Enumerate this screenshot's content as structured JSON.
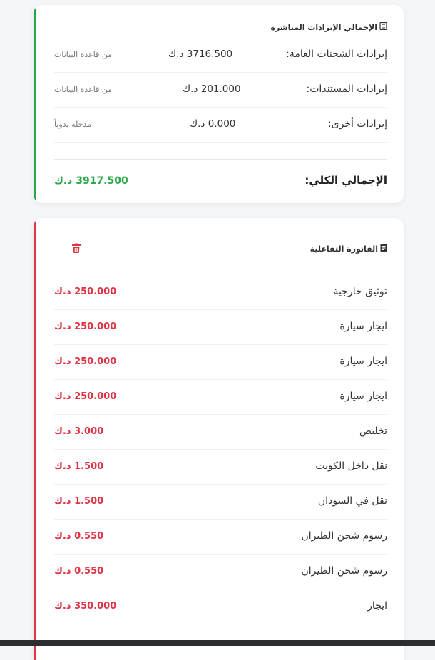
{
  "direct_revenue": {
    "title": "الإجمالي الإيرادات المباشرة",
    "icon": "calculator-icon",
    "accent_color": "#2aa74a",
    "rows": [
      {
        "label": "إيرادات الشحنات العامة:",
        "amount": "3716.500 د.ك",
        "source": "من قاعدة البيانات"
      },
      {
        "label": "إيرادات المستندات:",
        "amount": "201.000 د.ك",
        "source": "من قاعدة البيانات"
      },
      {
        "label": "إيرادات أخرى:",
        "amount": "0.000 د.ك",
        "source": "مدخلة يدوياً"
      }
    ],
    "total_label": "الإجمالي الكلي:",
    "total_value": "3917.500 د.ك"
  },
  "interactive_invoice": {
    "title": "الفاتورة التفاعلية",
    "icon": "invoice-icon",
    "delete_icon": "trash-icon",
    "accent_color": "#dc3545",
    "items": [
      {
        "name": "توثيق خارجية",
        "price": "250.000 د.ك"
      },
      {
        "name": "ايجار سيارة",
        "price": "250.000 د.ك"
      },
      {
        "name": "ايجار سيارة",
        "price": "250.000 د.ك"
      },
      {
        "name": "ايجار سيارة",
        "price": "250.000 د.ك"
      },
      {
        "name": "تخليص",
        "price": "3.000 د.ك"
      },
      {
        "name": "نقل داخل الكويت",
        "price": "1.500 د.ك"
      },
      {
        "name": "نقل في السودان",
        "price": "1.500 د.ك"
      },
      {
        "name": "رسوم شحن الطيران",
        "price": "0.550 د.ك"
      },
      {
        "name": "رسوم شحن الطيران",
        "price": "0.550 د.ك"
      },
      {
        "name": "ايجار",
        "price": "350.000 د.ك"
      }
    ]
  }
}
